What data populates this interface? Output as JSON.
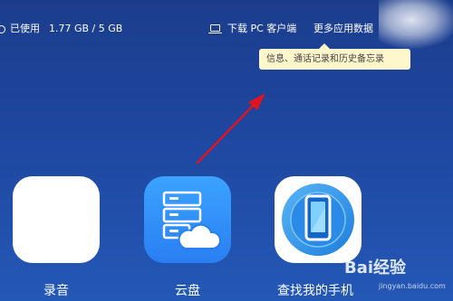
{
  "storage": {
    "label": "已使用",
    "value": "1.77 GB / 5 GB"
  },
  "header": {
    "download_label": "下载 PC 客户端",
    "more_data_label": "更多应用数据"
  },
  "tooltip": {
    "text": "信息、通话记录和历史备忘录"
  },
  "apps": [
    {
      "label": "录音",
      "icon": "waveform-icon"
    },
    {
      "label": "云盘",
      "icon": "cloud-storage-icon"
    },
    {
      "label": "查找我的手机",
      "icon": "phone-icon"
    }
  ],
  "watermark": {
    "brand": "Bai经验",
    "url": "jingyan.baidu.com"
  },
  "colors": {
    "background": "#1e47a0",
    "tooltip_bg": "#fff7cc",
    "arrow": "#e0141e",
    "cloud_tile": "#2a7ff2",
    "phone_ring": "#1e8de6"
  }
}
